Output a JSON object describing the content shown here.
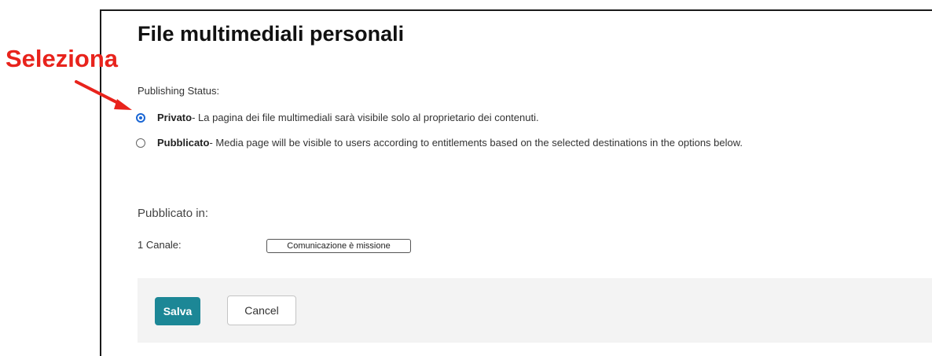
{
  "page": {
    "title": "File multimediali personali"
  },
  "publishing": {
    "label": "Publishing Status:",
    "options": [
      {
        "title": "Privato",
        "description": " - La pagina dei file multimediali sarà visibile solo al proprietario dei contenuti.",
        "selected": true
      },
      {
        "title": "Pubblicato",
        "description": " - Media page will be visible to users according to entitlements based on the selected destinations in the options below.",
        "selected": false
      }
    ]
  },
  "published_in": {
    "heading": "Pubblicato in:",
    "channel_count_label": "1 Canale:",
    "channel_name": "Comunicazione è missione"
  },
  "actions": {
    "save_label": "Salva",
    "cancel_label": "Cancel"
  },
  "annotation": {
    "callout_text": "Seleziona",
    "color": "#e8231c"
  },
  "colors": {
    "accent": "#1a66d4",
    "save_button": "#1c8796",
    "footer_background": "#f3f3f3"
  }
}
